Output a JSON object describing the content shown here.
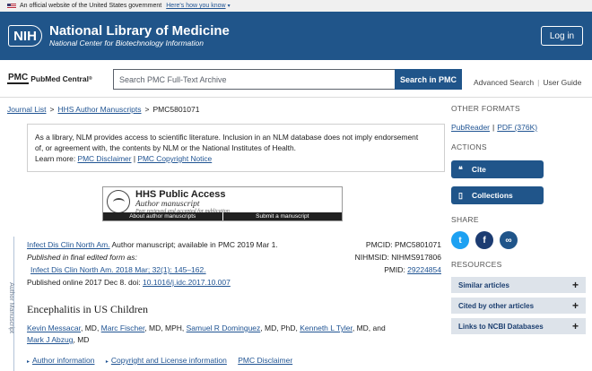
{
  "gov_banner": {
    "text": "An official website of the United States government",
    "link": "Here's how you know"
  },
  "header": {
    "logo": "NIH",
    "title": "National Library of Medicine",
    "subtitle": "National Center for Biotechnology Information",
    "login": "Log in"
  },
  "search": {
    "logo_box": "PMC",
    "logo_text": "PubMed Central",
    "logo_reg": "®",
    "placeholder": "Search PMC Full-Text Archive",
    "button": "Search in PMC",
    "advanced": "Advanced Search",
    "guide": "User Guide"
  },
  "breadcrumb": {
    "item1": "Journal List",
    "item2": "HHS Author Manuscripts",
    "current": "PMC5801071",
    "sep": ">"
  },
  "notice": {
    "line1": "As a library, NLM provides access to scientific literature. Inclusion in an NLM database does not imply endorsement",
    "line2": "of, or agreement with, the contents by NLM or the National Institutes of Health.",
    "learn": "Learn more:",
    "disclaimer": "PMC Disclaimer",
    "sep": "|",
    "copyright": "PMC Copyright Notice"
  },
  "hhs": {
    "title": "HHS Public Access",
    "sub1": "Author manuscript",
    "sub2": "Peer reviewed and accepted for publication",
    "link1": "About author manuscripts",
    "link2": "Submit a manuscript"
  },
  "side_label": "Author Manuscript",
  "citation": {
    "journal": "Infect Dis Clin North Am.",
    "rest": " Author manuscript; available in PMC 2019 Mar 1.",
    "published_as": "Published in final edited form as:",
    "final_ref": "Infect Dis Clin North Am. 2018 Mar; 32(1): 145–162.",
    "online_pre": "Published online 2017 Dec 8. doi: ",
    "doi": "10.1016/j.idc.2017.10.007"
  },
  "ids": {
    "pmcid": "PMCID: PMC5801071",
    "nihmsid": "NIHMSID: NIHMS917806",
    "pmid_label": "PMID: ",
    "pmid": "29224854"
  },
  "article": {
    "title": "Encephalitis in US Children",
    "authors": [
      {
        "name": "Kevin Messacar",
        "deg": ", MD, "
      },
      {
        "name": "Marc Fischer",
        "deg": ", MD, MPH, "
      },
      {
        "name": "Samuel R Dominguez",
        "deg": ", MD, PhD, "
      },
      {
        "name": "Kenneth L Tyler",
        "deg": ", MD, and "
      },
      {
        "name": "Mark J Abzug",
        "deg": ", MD"
      }
    ],
    "subnav": {
      "author_info": "Author information",
      "copyright": "Copyright and License information",
      "disclaimer": "PMC Disclaimer"
    }
  },
  "sidebar": {
    "other_formats": "OTHER FORMATS",
    "pubreader": "PubReader",
    "pdf": "PDF (376K)",
    "actions": "ACTIONS",
    "cite": "Cite",
    "collections": "Collections",
    "share": "SHARE",
    "resources": "RESOURCES",
    "res_items": [
      "Similar articles",
      "Cited by other articles",
      "Links to NCBI Databases"
    ]
  },
  "colors": {
    "header_bg": "#20558a",
    "link": "#205493",
    "button": "#20558a",
    "twitter": "#1da1f2",
    "facebook": "#1c3c72"
  }
}
